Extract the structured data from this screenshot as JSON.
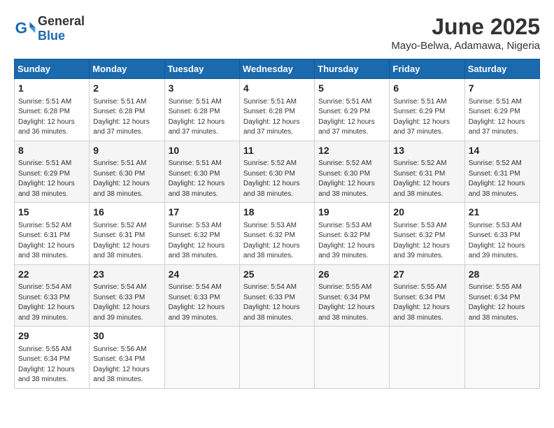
{
  "header": {
    "logo_general": "General",
    "logo_blue": "Blue",
    "month_title": "June 2025",
    "location": "Mayo-Belwa, Adamawa, Nigeria"
  },
  "days_of_week": [
    "Sunday",
    "Monday",
    "Tuesday",
    "Wednesday",
    "Thursday",
    "Friday",
    "Saturday"
  ],
  "weeks": [
    [
      {
        "day": "1",
        "sunrise": "5:51 AM",
        "sunset": "6:28 PM",
        "daylight": "12 hours and 36 minutes."
      },
      {
        "day": "2",
        "sunrise": "5:51 AM",
        "sunset": "6:28 PM",
        "daylight": "12 hours and 37 minutes."
      },
      {
        "day": "3",
        "sunrise": "5:51 AM",
        "sunset": "6:28 PM",
        "daylight": "12 hours and 37 minutes."
      },
      {
        "day": "4",
        "sunrise": "5:51 AM",
        "sunset": "6:28 PM",
        "daylight": "12 hours and 37 minutes."
      },
      {
        "day": "5",
        "sunrise": "5:51 AM",
        "sunset": "6:29 PM",
        "daylight": "12 hours and 37 minutes."
      },
      {
        "day": "6",
        "sunrise": "5:51 AM",
        "sunset": "6:29 PM",
        "daylight": "12 hours and 37 minutes."
      },
      {
        "day": "7",
        "sunrise": "5:51 AM",
        "sunset": "6:29 PM",
        "daylight": "12 hours and 37 minutes."
      }
    ],
    [
      {
        "day": "8",
        "sunrise": "5:51 AM",
        "sunset": "6:29 PM",
        "daylight": "12 hours and 38 minutes."
      },
      {
        "day": "9",
        "sunrise": "5:51 AM",
        "sunset": "6:30 PM",
        "daylight": "12 hours and 38 minutes."
      },
      {
        "day": "10",
        "sunrise": "5:51 AM",
        "sunset": "6:30 PM",
        "daylight": "12 hours and 38 minutes."
      },
      {
        "day": "11",
        "sunrise": "5:52 AM",
        "sunset": "6:30 PM",
        "daylight": "12 hours and 38 minutes."
      },
      {
        "day": "12",
        "sunrise": "5:52 AM",
        "sunset": "6:30 PM",
        "daylight": "12 hours and 38 minutes."
      },
      {
        "day": "13",
        "sunrise": "5:52 AM",
        "sunset": "6:31 PM",
        "daylight": "12 hours and 38 minutes."
      },
      {
        "day": "14",
        "sunrise": "5:52 AM",
        "sunset": "6:31 PM",
        "daylight": "12 hours and 38 minutes."
      }
    ],
    [
      {
        "day": "15",
        "sunrise": "5:52 AM",
        "sunset": "6:31 PM",
        "daylight": "12 hours and 38 minutes."
      },
      {
        "day": "16",
        "sunrise": "5:52 AM",
        "sunset": "6:31 PM",
        "daylight": "12 hours and 38 minutes."
      },
      {
        "day": "17",
        "sunrise": "5:53 AM",
        "sunset": "6:32 PM",
        "daylight": "12 hours and 38 minutes."
      },
      {
        "day": "18",
        "sunrise": "5:53 AM",
        "sunset": "6:32 PM",
        "daylight": "12 hours and 38 minutes."
      },
      {
        "day": "19",
        "sunrise": "5:53 AM",
        "sunset": "6:32 PM",
        "daylight": "12 hours and 39 minutes."
      },
      {
        "day": "20",
        "sunrise": "5:53 AM",
        "sunset": "6:32 PM",
        "daylight": "12 hours and 39 minutes."
      },
      {
        "day": "21",
        "sunrise": "5:53 AM",
        "sunset": "6:33 PM",
        "daylight": "12 hours and 39 minutes."
      }
    ],
    [
      {
        "day": "22",
        "sunrise": "5:54 AM",
        "sunset": "6:33 PM",
        "daylight": "12 hours and 39 minutes."
      },
      {
        "day": "23",
        "sunrise": "5:54 AM",
        "sunset": "6:33 PM",
        "daylight": "12 hours and 39 minutes."
      },
      {
        "day": "24",
        "sunrise": "5:54 AM",
        "sunset": "6:33 PM",
        "daylight": "12 hours and 39 minutes."
      },
      {
        "day": "25",
        "sunrise": "5:54 AM",
        "sunset": "6:33 PM",
        "daylight": "12 hours and 38 minutes."
      },
      {
        "day": "26",
        "sunrise": "5:55 AM",
        "sunset": "6:34 PM",
        "daylight": "12 hours and 38 minutes."
      },
      {
        "day": "27",
        "sunrise": "5:55 AM",
        "sunset": "6:34 PM",
        "daylight": "12 hours and 38 minutes."
      },
      {
        "day": "28",
        "sunrise": "5:55 AM",
        "sunset": "6:34 PM",
        "daylight": "12 hours and 38 minutes."
      }
    ],
    [
      {
        "day": "29",
        "sunrise": "5:55 AM",
        "sunset": "6:34 PM",
        "daylight": "12 hours and 38 minutes."
      },
      {
        "day": "30",
        "sunrise": "5:56 AM",
        "sunset": "6:34 PM",
        "daylight": "12 hours and 38 minutes."
      },
      null,
      null,
      null,
      null,
      null
    ]
  ]
}
